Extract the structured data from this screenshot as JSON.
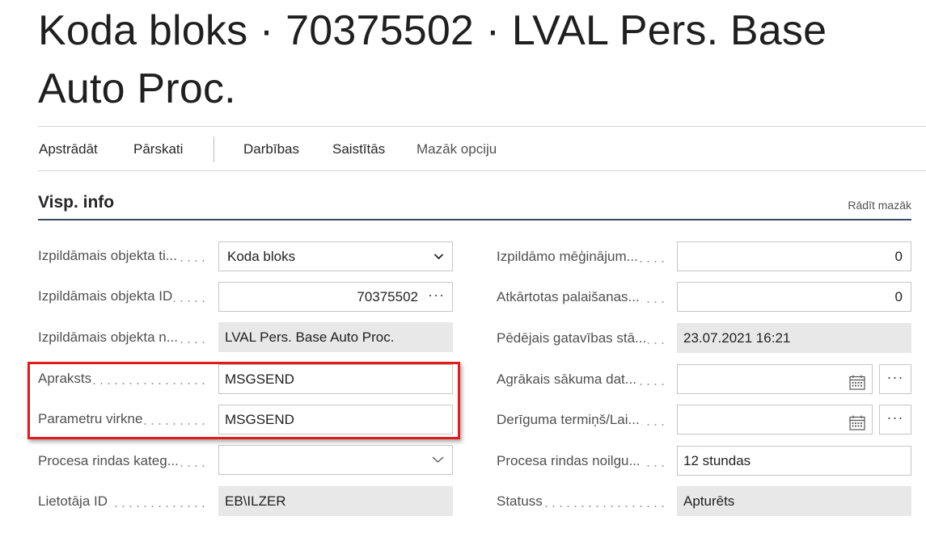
{
  "page": {
    "title": "Koda bloks · 70375502 · LVAL Pers. Base Auto Proc."
  },
  "actions": {
    "process": "Apstrādāt",
    "reports": "Pārskati",
    "actions": "Darbības",
    "related": "Saistītās",
    "fewer_options": "Mazāk opciju"
  },
  "section": {
    "title": "Visp. info",
    "show_less": "Rādīt mazāk"
  },
  "left_fields": {
    "object_type": {
      "label": "Izpildāmais objekta ti...",
      "value": "Koda bloks"
    },
    "object_id": {
      "label": "Izpildāmais objekta ID",
      "value": "70375502"
    },
    "object_name": {
      "label": "Izpildāmais objekta n...",
      "value": "LVAL Pers. Base Auto Proc."
    },
    "description": {
      "label": "Apraksts",
      "value": "MSGSEND"
    },
    "parameter_string": {
      "label": "Parametru virkne",
      "value": "MSGSEND"
    },
    "queue_category": {
      "label": "Procesa rindas kateg...",
      "value": ""
    },
    "user_id": {
      "label": "Lietotāja ID",
      "value": "EB\\ILZER"
    }
  },
  "right_fields": {
    "attempts": {
      "label": "Izpildāmo mēģinājum...",
      "value": "0"
    },
    "rerun": {
      "label": "Atkārtotas palaišanas...",
      "value": "0"
    },
    "last_ready": {
      "label": "Pēdējais gatavības stā...",
      "value": "23.07.2021 16:21"
    },
    "earliest_start": {
      "label": "Agrākais sākuma dat...",
      "value": ""
    },
    "expiration": {
      "label": "Derīguma termiņš/Lai...",
      "value": ""
    },
    "queue_timeout": {
      "label": "Procesa rindas noilgu...",
      "value": "12 stundas"
    },
    "status": {
      "label": "Statuss",
      "value": "Apturēts"
    }
  },
  "icons": {
    "dropdown": "chevron-down-icon",
    "lookup": "ellipsis-icon",
    "calendar": "calendar-icon"
  },
  "colors": {
    "highlight": "#e31b1b",
    "section_rule": "#3b4a63",
    "readonly_bg": "#e8e8e8"
  }
}
